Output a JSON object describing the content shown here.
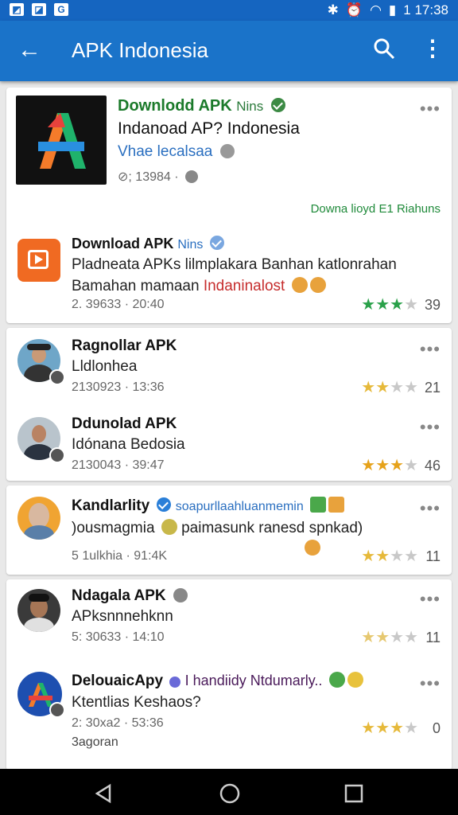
{
  "status_bar": {
    "time": "1 17:38"
  },
  "app_bar": {
    "title": "APK Indonesia"
  },
  "featured": {
    "title": "Downlodd APK",
    "title_suffix": "Nins",
    "subtitle": "Indanoad AP? Indonesia",
    "author": "Vhae lecalsaa",
    "meta": "⊘; 13984 ·",
    "link": "Downa lioyd E1 Riahuns"
  },
  "posts": [
    {
      "title": "Download APK",
      "title_suffix": "Nins",
      "line1": "Pladneata APKs lilmplakara Banhan katlonrahan",
      "line2": "Bamahan mamaan",
      "line2_accent": "Indaninalost",
      "meta": "2. 39633 · 20:40",
      "rating": 3,
      "rating_color": "#2aa14a",
      "count": "39"
    },
    {
      "title": "Ragnollar APK",
      "line1": "Lldlonhea",
      "meta": "2130923 · 13:36",
      "rating": 2,
      "rating_color": "#e6b93a",
      "count": "21"
    },
    {
      "title": "Ddunolad APK",
      "line1": "Idónana Bedosia",
      "meta": "2130043 · 39:47",
      "rating": 3,
      "rating_color": "#e6a21a",
      "count": "46"
    },
    {
      "title": "Kandlarlity",
      "title_suffix": "soapurllaahluanmemin",
      "line1": ")ousmagmia",
      "line1b": "paimasunk ranesd spnkad)",
      "meta": "5 1ulkhia · 91:4K",
      "rating": 2,
      "rating_color": "#e6b93a",
      "count": "11"
    },
    {
      "title": "Ndagala APK",
      "line1": "APksnnnehknn",
      "meta": "5: 30633 · 14:10",
      "rating": 2,
      "rating_color": "#e6c870",
      "count": "11"
    },
    {
      "title": "DelouaicApy",
      "title_suffix": "I handiidy Ntdumarly..",
      "line1": "Ktentlias Keshaos?",
      "meta": "2: 30xa2 · 53:36",
      "line3": "3agoran",
      "rating": 3,
      "rating_color": "#e6b93a",
      "count": "0"
    }
  ]
}
